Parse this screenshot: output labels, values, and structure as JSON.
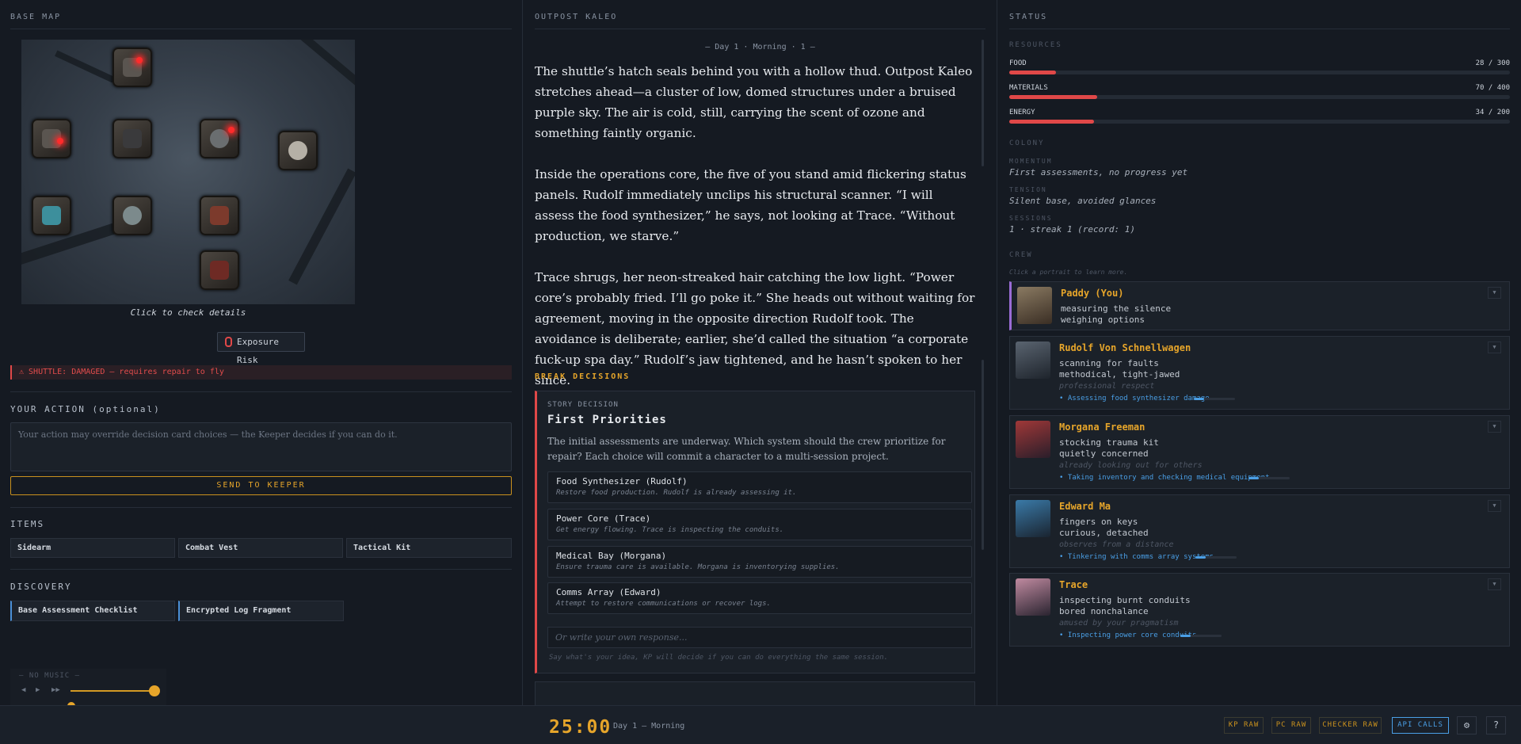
{
  "panels": {
    "left": "BASE MAP",
    "middle": "OUTPOST KALEO",
    "right": "STATUS"
  },
  "map": {
    "caption": "Click to check details",
    "exposure_label": "Exposure Risk"
  },
  "shuttle_warning": "⚠ SHUTTLE: DAMAGED — requires repair to fly",
  "action": {
    "heading": "YOUR ACTION (optional)",
    "placeholder": "Your action may override decision card choices — the Keeper decides if you can do it.",
    "send_label": "SEND TO KEEPER"
  },
  "items": {
    "heading": "ITEMS",
    "list": [
      "Sidearm",
      "Combat Vest",
      "Tactical Kit"
    ]
  },
  "discovery": {
    "heading": "DISCOVERY",
    "list": [
      "Base Assessment Checklist",
      "Encrypted Log Fragment"
    ]
  },
  "music": {
    "label": "— NO MUSIC —",
    "prev": "◀",
    "play": "▶",
    "next": "▶▶",
    "volume": 0.85
  },
  "story": {
    "day_line": "— Day 1 · Morning · 1 —",
    "paragraphs": [
      "The shuttle’s hatch seals behind you with a hollow thud. Outpost Kaleo stretches ahead—a cluster of low, domed structures under a bruised purple sky. The air is cold, still, carrying the scent of ozone and something faintly organic.",
      "Inside the operations core, the five of you stand amid flickering status panels. Rudolf immediately unclips his structural scanner. “I will assess the food synthesizer,” he says, not looking at Trace. “Without production, we starve.”",
      "Trace shrugs, her neon-streaked hair catching the low light. “Power core’s probably fried. I’ll go poke it.” She heads out without waiting for agreement, moving in the opposite direction Rudolf took. The avoidance is deliberate; earlier, she’d called the situation “a corporate fuck-up spa day.” Rudolf’s jaw tightened, and he hasn’t spoken to her since."
    ]
  },
  "decisions": {
    "heading": "BREAK DECISIONS",
    "tag": "STORY DECISION",
    "title": "First Priorities",
    "description": "The initial assessments are underway. Which system should the crew prioritize for repair? Each choice will commit a character to a multi-session project.",
    "choices": [
      {
        "label": "Food Synthesizer (Rudolf)",
        "sub": "Restore food production. Rudolf is already assessing it."
      },
      {
        "label": "Power Core (Trace)",
        "sub": "Get energy flowing. Trace is inspecting the conduits."
      },
      {
        "label": "Medical Bay (Morgana)",
        "sub": "Ensure trauma care is available. Morgana is inventorying supplies."
      },
      {
        "label": "Comms Array (Edward)",
        "sub": "Attempt to restore communications or recover logs."
      }
    ],
    "own_placeholder": "Or write your own response...",
    "hint": "Say what's your idea, KP will decide if you can do everything the same session."
  },
  "status": {
    "resources_heading": "RESOURCES",
    "resources": [
      {
        "name": "FOOD",
        "value": "28 / 300",
        "fraction": 0.093
      },
      {
        "name": "MATERIALS",
        "value": "70 / 400",
        "fraction": 0.175
      },
      {
        "name": "ENERGY",
        "value": "34 / 200",
        "fraction": 0.17
      }
    ],
    "colony_heading": "COLONY",
    "momentum_label": "MOMENTUM",
    "momentum": "First assessments, no progress yet",
    "tension_label": "TENSION",
    "tension": "Silent base, avoided glances",
    "sessions_label": "SESSIONS",
    "sessions": "1 · streak 1 (record: 1)",
    "crew_heading": "CREW",
    "crew_hint": "Click a portrait to learn more.",
    "crew": [
      {
        "name": "Paddy (You)",
        "line1": "measuring the silence",
        "line2": "weighing options",
        "relation": "",
        "task": "",
        "progress": 0
      },
      {
        "name": "Rudolf Von Schnellwagen",
        "line1": "scanning for faults",
        "line2": "methodical, tight-jawed",
        "relation": "professional respect",
        "task": "• Assessing food synthesizer damage",
        "progress": 0.25
      },
      {
        "name": "Morgana Freeman",
        "line1": "stocking trauma kit",
        "line2": "quietly concerned",
        "relation": "already looking out for others",
        "task": "• Taking inventory and checking medical equipment",
        "progress": 0.25
      },
      {
        "name": "Edward Ma",
        "line1": "fingers on keys",
        "line2": "curious, detached",
        "relation": "observes from a distance",
        "task": "• Tinkering with comms array systems",
        "progress": 0.25
      },
      {
        "name": "Trace",
        "line1": "inspecting burnt conduits",
        "line2": "bored nonchalance",
        "relation": "amused by your pragmatism",
        "task": "• Inspecting power core conduits",
        "progress": 0.25
      }
    ]
  },
  "footer": {
    "timer": "25:00",
    "day": "Day 1 — Morning",
    "buttons": [
      "KP RAW",
      "PC RAW",
      "CHECKER RAW",
      "API CALLS"
    ],
    "settings_icon": "⚙",
    "help": "?"
  },
  "colors": {
    "accent": "#e6a52a",
    "danger": "#e04848",
    "info": "#4a9fe6",
    "bg": "#151a22"
  }
}
